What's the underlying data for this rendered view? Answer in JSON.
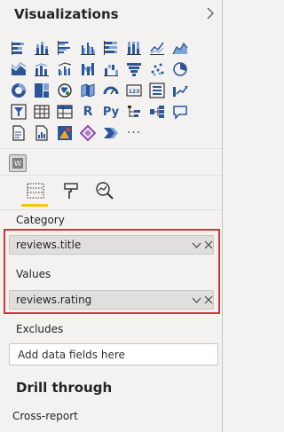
{
  "pane": {
    "title": "Visualizations"
  },
  "gallery": {
    "rows": [
      [
        "stacked-bar-chart-icon",
        "stacked-column-chart-icon",
        "clustered-bar-chart-icon",
        "clustered-column-chart-icon",
        "100-stacked-bar-chart-icon",
        "100-stacked-column-chart-icon",
        "line-chart-icon",
        "area-chart-icon"
      ],
      [
        "stacked-area-chart-icon",
        "line-and-stacked-column-icon",
        "line-and-clustered-column-icon",
        "ribbon-chart-icon",
        "waterfall-chart-icon",
        "funnel-chart-icon",
        "scatter-chart-icon",
        "pie-chart-icon"
      ],
      [
        "donut-chart-icon",
        "treemap-icon",
        "map-icon",
        "filled-map-icon",
        "gauge-icon",
        "card-icon",
        "multi-row-card-icon",
        "kpi-icon"
      ],
      [
        "slicer-icon",
        "table-icon",
        "matrix-icon",
        "r-visual-icon",
        "python-visual-icon",
        "key-influencers-icon",
        "decomposition-tree-icon",
        "qa-icon"
      ],
      [
        "smart-narrative-icon",
        "paginated-report-icon",
        "arcgis-map-icon",
        "power-apps-icon",
        "power-automate-icon",
        "more-visuals-icon"
      ]
    ],
    "r_label": "R",
    "py_label": "Py",
    "more_label": "···",
    "custom_visual_label": "W"
  },
  "tabs": [
    "build-visual-tab",
    "format-visual-tab",
    "analytics-tab"
  ],
  "wells": {
    "category_label": "Category",
    "category_value": "reviews.title",
    "values_label": "Values",
    "values_value": "reviews.rating",
    "excludes_label": "Excludes",
    "excludes_placeholder": "Add data fields here"
  },
  "drill": {
    "title": "Drill through",
    "cross_report_label": "Cross-report"
  },
  "colors": {
    "accent_yellow": "#f2c811",
    "highlight_red": "#d13438",
    "icon_blue": "#2b579a"
  }
}
